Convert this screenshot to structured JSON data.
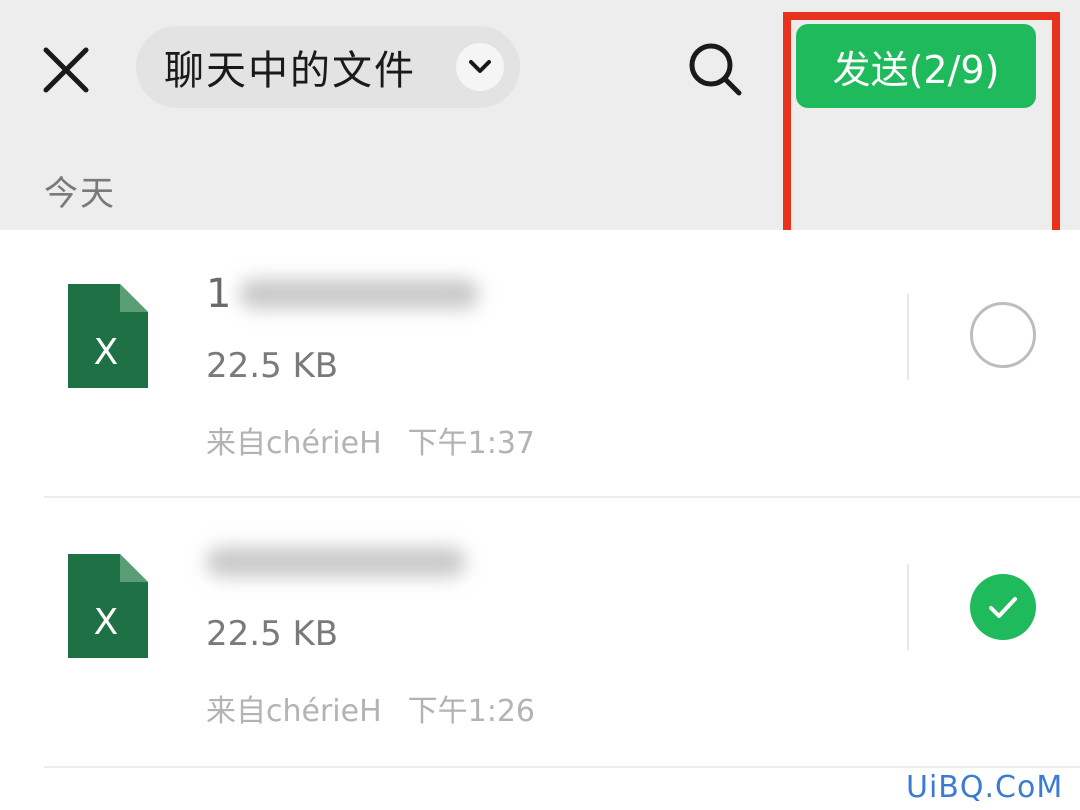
{
  "header": {
    "title": "聊天中的文件",
    "send_label": "发送(2/9)"
  },
  "colors": {
    "accent": "#1fba5b",
    "highlight": "#e8321e",
    "header_bg": "#ededed",
    "excel_icon": "#1e7145"
  },
  "section": {
    "label": "今天"
  },
  "files": [
    {
      "icon": "excel-file-icon",
      "name_visible": "1",
      "size": "22.5 KB",
      "sender": "来自chérieH",
      "time": "下午1:37",
      "selected": false
    },
    {
      "icon": "excel-file-icon",
      "name_visible": "",
      "size": "22.5 KB",
      "sender": "来自chérieH",
      "time": "下午1:26",
      "selected": true
    }
  ],
  "watermark": "UiBQ.CoM"
}
